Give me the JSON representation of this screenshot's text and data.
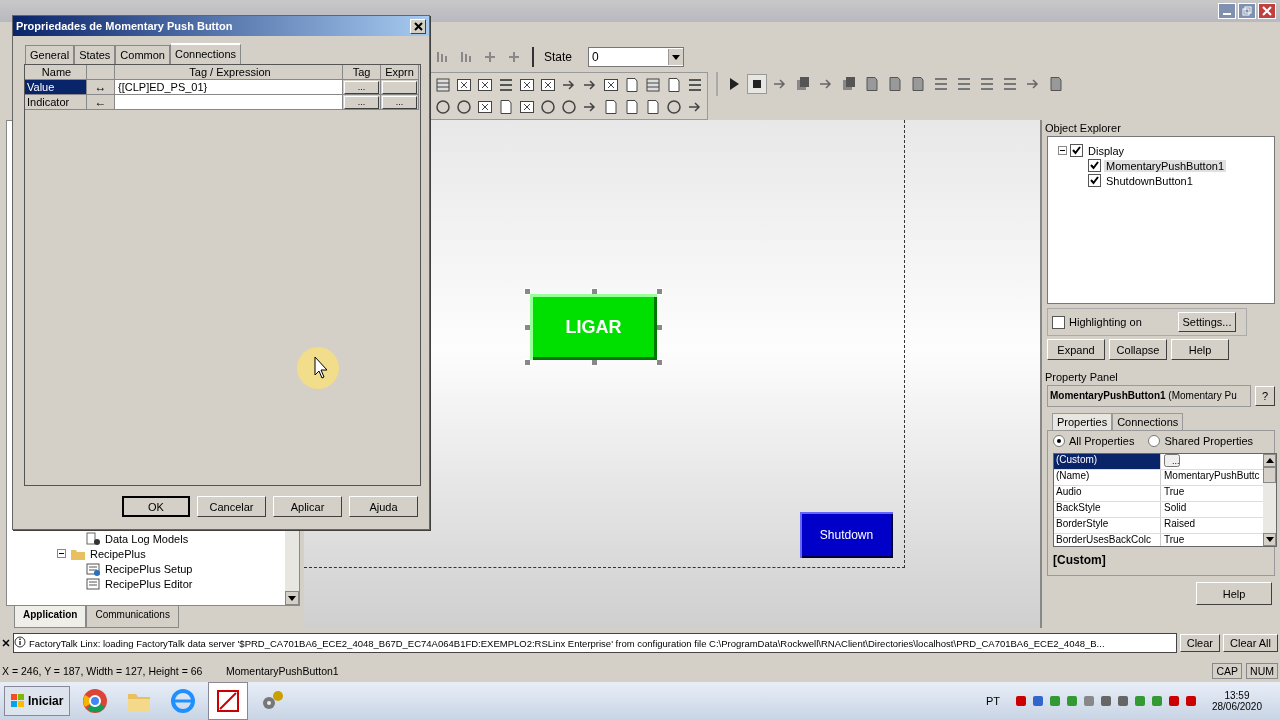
{
  "dialog": {
    "title": "Propriedades de Momentary Push Button",
    "tabs": [
      {
        "label": "General",
        "selected": false
      },
      {
        "label": "States",
        "selected": false
      },
      {
        "label": "Common",
        "selected": false
      },
      {
        "label": "Connections",
        "selected": true
      }
    ],
    "columns": [
      "Name",
      "Tag / Expression",
      "Tag",
      "Exprn"
    ],
    "rows": [
      {
        "name": "Value",
        "direction": "↔",
        "expression": "{[CLP]ED_PS_01}",
        "tag_button": "...",
        "selected": true
      },
      {
        "name": "Indicator",
        "direction": "←",
        "tag_button": "...",
        "exprn_button": "...",
        "selected": false
      }
    ],
    "buttons": [
      "OK",
      "Cancelar",
      "Aplicar",
      "Ajuda"
    ]
  },
  "toolbar": {
    "state_label": "State",
    "state_value": "0"
  },
  "canvas": {
    "buttons": [
      {
        "label": "LIGAR",
        "color": "#00e000",
        "selected": true
      },
      {
        "label": "Shutdown",
        "color": "#0000c8",
        "selected": false
      }
    ]
  },
  "project_tree": {
    "items": [
      {
        "label": "Data Log Models",
        "kind": "database"
      },
      {
        "label": "RecipePlus",
        "kind": "folder",
        "expanded": true,
        "children": [
          {
            "label": "RecipePlus Setup",
            "kind": "setup"
          },
          {
            "label": "RecipePlus Editor",
            "kind": "editor"
          }
        ]
      }
    ],
    "tabs": [
      {
        "label": "Application",
        "selected": true
      },
      {
        "label": "Communications",
        "selected": false
      }
    ]
  },
  "object_explorer": {
    "title": "Object Explorer",
    "tree": [
      {
        "label": "Display",
        "checked": true,
        "expanded": true,
        "selected": false,
        "children": [
          {
            "label": "MomentaryPushButton1",
            "checked": true,
            "selected": true
          },
          {
            "label": "ShutdownButton1",
            "checked": true,
            "selected": false
          }
        ]
      }
    ],
    "highlighting": {
      "label": "Highlighting on",
      "checked": false
    },
    "settings": "Settings...",
    "buttons": [
      "Expand",
      "Collapse",
      "Help"
    ]
  },
  "property_panel": {
    "title": "Property Panel",
    "object_name": "MomentaryPushButton1",
    "object_type": "(Momentary Pu",
    "help_mark": "?",
    "tabs": [
      {
        "label": "Properties",
        "selected": true
      },
      {
        "label": "Connections",
        "selected": false
      }
    ],
    "scope": [
      {
        "label": "All Properties",
        "selected": true
      },
      {
        "label": "Shared Properties",
        "selected": false
      }
    ],
    "rows": [
      {
        "name": "(Custom)",
        "selected": true,
        "edit_button": "..."
      },
      {
        "name": "(Name)",
        "value": "MomentaryPushButtc",
        "selected": false
      },
      {
        "name": "Audio",
        "value": "True",
        "selected": false
      },
      {
        "name": "BackStyle",
        "value": "Solid",
        "selected": false
      },
      {
        "name": "BorderStyle",
        "value": "Raised",
        "selected": false
      },
      {
        "name": "BorderUsesBackColc",
        "value": "True",
        "selected": false
      }
    ],
    "description_title": "[Custom]",
    "help": "Help"
  },
  "output": {
    "message": "FactoryTalk Linx: loading FactoryTalk data server '$PRD_CA701BA6_ECE2_4048_B67D_EC74A064B1FD:EXEMPLO2:RSLinx Enterprise' from configuration file C:\\ProgramData\\Rockwell\\RNAClient\\Directories\\localhost\\PRD_CA701BA6_ECE2_4048_B...",
    "buttons": [
      "Clear",
      "Clear All"
    ]
  },
  "status_bar": {
    "position": "X = 246, Y = 187, Width = 127, Height = 66",
    "selection": "MomentaryPushButton1",
    "indicators": [
      "CAP",
      "NUM"
    ]
  },
  "taskbar": {
    "start": "Iniciar",
    "language": "PT",
    "time": "13:59",
    "date": "28/06/2020"
  }
}
